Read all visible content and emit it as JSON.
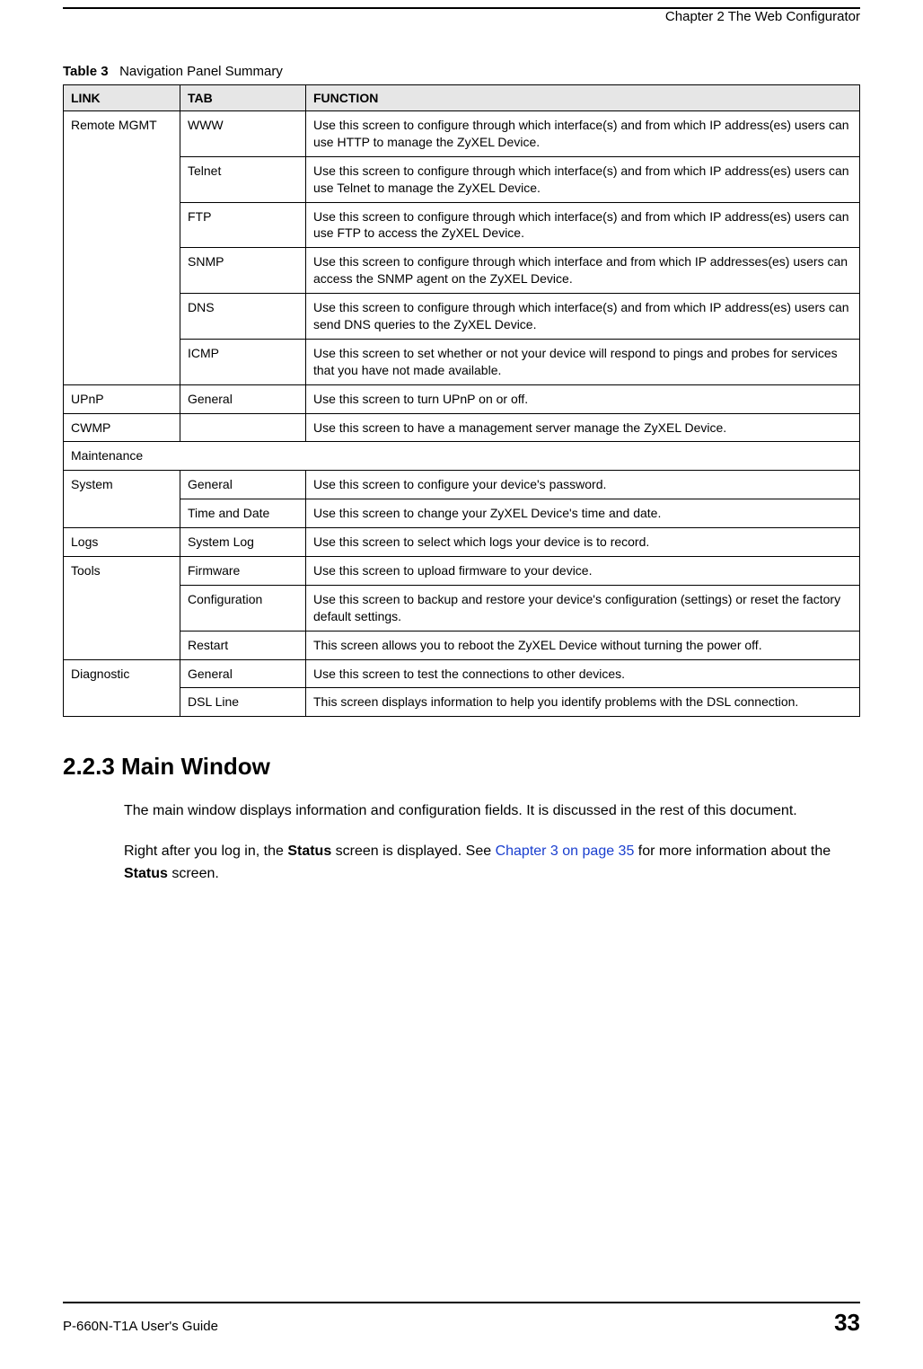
{
  "header": {
    "chapter": "Chapter 2 The Web Configurator"
  },
  "table": {
    "caption_label": "Table 3",
    "caption_title": "Navigation Panel Summary",
    "headers": {
      "link": "LINK",
      "tab": "TAB",
      "function": "FUNCTION"
    },
    "rows": {
      "remote_mgmt_link": "Remote MGMT",
      "www_tab": "WWW",
      "www_fn": "Use this screen to configure through which interface(s) and from which IP address(es) users can use HTTP to manage the ZyXEL Device.",
      "telnet_tab": "Telnet",
      "telnet_fn": "Use this screen to configure through which interface(s) and from which IP address(es) users can use Telnet to manage the ZyXEL Device.",
      "ftp_tab": "FTP",
      "ftp_fn": "Use this screen to configure through which interface(s) and from which IP address(es) users can use FTP to access the ZyXEL Device.",
      "snmp_tab": "SNMP",
      "snmp_fn": "Use this screen to configure through which interface and from which IP addresses(es) users can access the SNMP agent on the ZyXEL Device.",
      "dns_tab": "DNS",
      "dns_fn": "Use this screen to configure through which interface(s) and from which IP address(es) users can send DNS queries to the ZyXEL Device.",
      "icmp_tab": "ICMP",
      "icmp_fn": "Use this screen to set whether or not your device will respond to pings and probes for services that you have not made available.",
      "upnp_link": "UPnP",
      "upnp_tab": "General",
      "upnp_fn": "Use this screen to turn UPnP on or off.",
      "cwmp_link": "CWMP",
      "cwmp_fn": "Use this screen to have a management server manage the ZyXEL Device.",
      "maintenance_link": "Maintenance",
      "system_link": "System",
      "system_general_tab": "General",
      "system_general_fn": "Use this screen to configure your device's password.",
      "system_time_tab": "Time and Date",
      "system_time_fn": "Use this screen to change your ZyXEL Device's time and date.",
      "logs_link": "Logs",
      "logs_tab": "System Log",
      "logs_fn": "Use this screen to select which logs your device is to record.",
      "tools_link": "Tools",
      "tools_firmware_tab": "Firmware",
      "tools_firmware_fn": "Use this screen to upload firmware to your device.",
      "tools_config_tab": "Configuration",
      "tools_config_fn": "Use this screen to backup and restore your device's configuration (settings) or reset the factory default settings.",
      "tools_restart_tab": "Restart",
      "tools_restart_fn": "This screen allows you to reboot the ZyXEL Device without turning the power off.",
      "diag_link": "Diagnostic",
      "diag_general_tab": "General",
      "diag_general_fn": "Use this screen to test the connections to other devices.",
      "diag_dsl_tab": "DSL Line",
      "diag_dsl_fn": "This screen displays information to help you identify problems with the DSL connection."
    }
  },
  "section": {
    "heading": "2.2.3  Main Window",
    "para1": "The main window displays information and configuration fields. It is discussed in the rest of this document.",
    "para2_pre": "Right after you log in, the ",
    "para2_bold1": "Status",
    "para2_mid": " screen is displayed. See ",
    "para2_link": "Chapter 3 on page 35",
    "para2_post": " for more information about the ",
    "para2_bold2": "Status",
    "para2_end": " screen."
  },
  "footer": {
    "guide": "P-660N-T1A User's Guide",
    "page": "33"
  }
}
